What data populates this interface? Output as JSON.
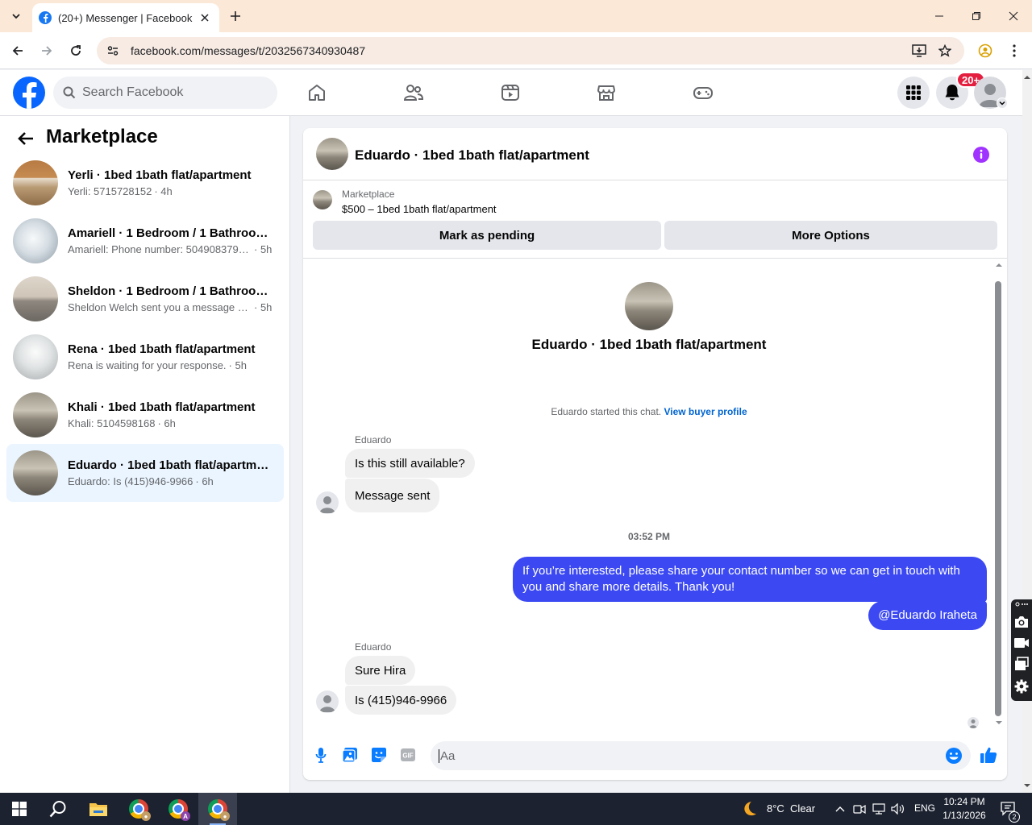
{
  "browser": {
    "tab_title": "(20+) Messenger | Facebook",
    "url": "facebook.com/messages/t/2032567340930487"
  },
  "header": {
    "search_placeholder": "Search Facebook",
    "notification_count": "20+",
    "brand_color": "#0866ff"
  },
  "sidebar": {
    "title": "Marketplace",
    "conversations": [
      {
        "name": "Yerli · 1bed 1bath flat/apartment",
        "preview": "Yerli: 5715728152",
        "time": "· 4h",
        "thumb": "room-kitchen"
      },
      {
        "name": "Amariell · 1 Bedroom / 1 Bathroom...",
        "preview": "Amariell: Phone number: 5049083793 ...",
        "time": "· 5h",
        "thumb": "room-white"
      },
      {
        "name": "Sheldon · 1 Bedroom / 1 Bathroom...",
        "preview": "Sheldon Welch sent you a message a...",
        "time": "· 5h",
        "thumb": "room-beige"
      },
      {
        "name": "Rena · 1bed 1bath flat/apartment",
        "preview": "Rena is waiting for your response.",
        "time": "· 5h",
        "thumb": "room-bath"
      },
      {
        "name": "Khali · 1bed 1bath flat/apartment",
        "preview": "Khali: 5104598168",
        "time": "· 6h",
        "thumb": "room-carpet"
      },
      {
        "name": "Eduardo · 1bed 1bath flat/apartment",
        "preview": "Eduardo: Is (415)946-9966",
        "time": "· 6h",
        "thumb": "room-carpet",
        "active": true
      }
    ]
  },
  "chat": {
    "title": "Eduardo · 1bed 1bath flat/apartment",
    "marketplace_label": "Marketplace",
    "listing": "$500 – 1bed 1bath flat/apartment",
    "mark_pending": "Mark as pending",
    "more_options": "More Options",
    "intro_name": "Eduardo · 1bed 1bath flat/apartment",
    "started_note": "Eduardo started this chat.",
    "view_profile": "View buyer profile",
    "group1_sender": "Eduardo",
    "group1_msg1": "Is this still available?",
    "group1_msg2": "Message sent",
    "timestamp": "03:52 PM",
    "out_msg1": "If you’re interested, please share your contact number so we can get in touch with you and share more details. Thank you!",
    "out_msg2": "@Eduardo Iraheta",
    "group2_sender": "Eduardo",
    "group2_msg1": "Sure Hira",
    "group2_msg2": "Is (415)946-9966",
    "composer_placeholder": "Aa",
    "outgoing_color": "#3c49f2",
    "accent_color": "#a033ff"
  },
  "taskbar": {
    "weather": "8°C  Clear",
    "language": "ENG",
    "time": "10:24 PM",
    "date": "1/13/2026",
    "notif_count": "2"
  }
}
